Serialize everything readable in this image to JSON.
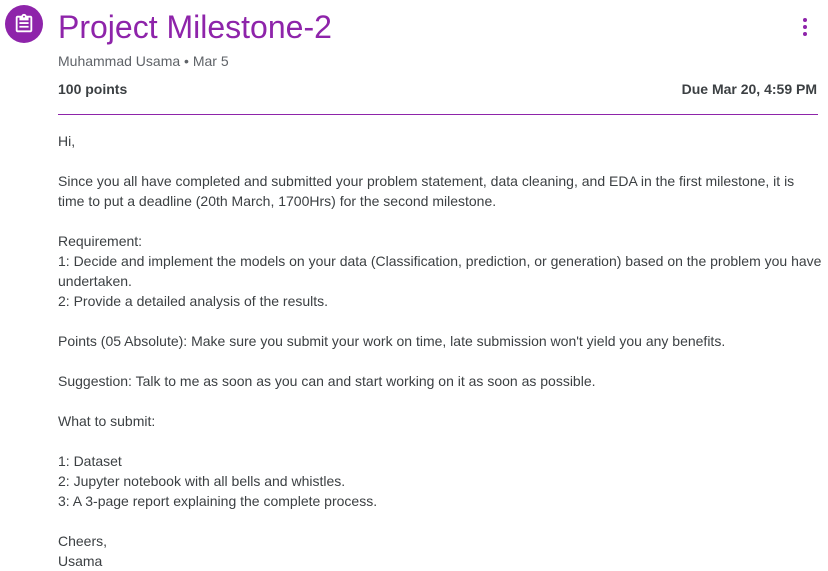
{
  "header": {
    "icon": "assignment-icon",
    "title": "Project Milestone-2",
    "more_icon": "more-vert-icon"
  },
  "meta": {
    "author": "Muhammad Usama",
    "separator": "•",
    "date": "Mar 5"
  },
  "points": "100 points",
  "due": "Due Mar 20, 4:59 PM",
  "colors": {
    "accent": "#8e24aa",
    "text": "#3c4043",
    "secondary_text": "#5f6368"
  },
  "body": [
    "Hi,",
    "",
    "Since you all have completed and submitted your problem statement, data cleaning, and EDA in the first milestone, it is time to put a deadline (20th March, 1700Hrs) for the second milestone.",
    "",
    "Requirement:",
    "1: Decide and implement the models on your data (Classification, prediction, or generation) based on the problem you have undertaken.",
    "2: Provide a detailed analysis of the results.",
    "",
    "Points (05 Absolute): Make sure you submit your work on time, late submission won't yield you any benefits.",
    "",
    "Suggestion: Talk to me as soon as you can and start working on it as soon as possible.",
    "",
    "What to submit:",
    "",
    "1: Dataset",
    "2: Jupyter notebook with all bells and whistles.",
    "3: A 3-page report explaining the complete process.",
    "",
    "Cheers,",
    "Usama"
  ]
}
